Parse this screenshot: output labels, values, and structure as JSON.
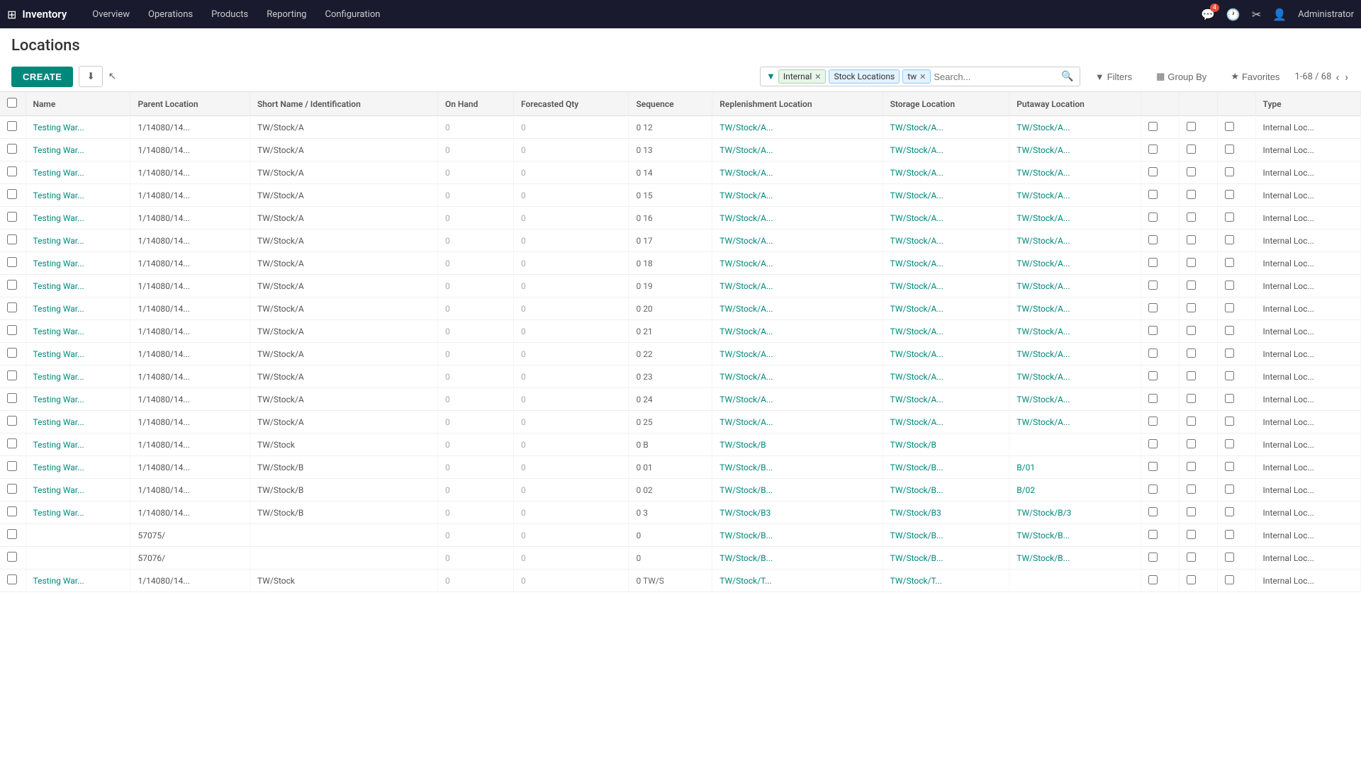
{
  "app": {
    "name": "Inventory",
    "grid_icon": "⊞",
    "nav_items": [
      "Overview",
      "Operations",
      "Products",
      "Reporting",
      "Configuration"
    ]
  },
  "topnav_right": {
    "chat_icon": "💬",
    "chat_badge": "4",
    "clock_icon": "🕐",
    "settings_icon": "⚙",
    "user_icon": "👤",
    "admin_name": "Administrator"
  },
  "page": {
    "title": "Locations"
  },
  "toolbar": {
    "create_label": "CREATE",
    "download_icon": "⬇",
    "filters_label": "Filters",
    "groupby_label": "Group By",
    "favorites_label": "Favorites",
    "filter_internal": "Internal",
    "filter_stock": "Stock Locations",
    "filter_tw": "tw",
    "search_placeholder": "Search...",
    "pagination": "1-68 / 68"
  },
  "table": {
    "columns": [
      "",
      "Name",
      "Parent Location",
      "Short Name / Identification",
      "On Hand",
      "Forecasted Qty",
      "Sequence",
      "Replenishment Location",
      "Storage Location",
      "Putaway Location",
      "",
      "",
      "",
      "Type"
    ],
    "rows": [
      {
        "name": "Testing War...",
        "parent": "1/14080/14...",
        "short": "TW/Stock/A",
        "on_hand": "0",
        "forecast": "0",
        "seq": "0",
        "seq2": "12",
        "loc1": "TW/Stock/A...",
        "loc2": "TW/Stock/A...",
        "loc3": "TW/Stock/A...",
        "type": "Internal Loc..."
      },
      {
        "name": "Testing War...",
        "parent": "1/14080/14...",
        "short": "TW/Stock/A",
        "on_hand": "0",
        "forecast": "0",
        "seq": "0",
        "seq2": "13",
        "loc1": "TW/Stock/A...",
        "loc2": "TW/Stock/A...",
        "loc3": "TW/Stock/A...",
        "type": "Internal Loc..."
      },
      {
        "name": "Testing War...",
        "parent": "1/14080/14...",
        "short": "TW/Stock/A",
        "on_hand": "0",
        "forecast": "0",
        "seq": "0",
        "seq2": "14",
        "loc1": "TW/Stock/A...",
        "loc2": "TW/Stock/A...",
        "loc3": "TW/Stock/A...",
        "type": "Internal Loc..."
      },
      {
        "name": "Testing War...",
        "parent": "1/14080/14...",
        "short": "TW/Stock/A",
        "on_hand": "0",
        "forecast": "0",
        "seq": "0",
        "seq2": "15",
        "loc1": "TW/Stock/A...",
        "loc2": "TW/Stock/A...",
        "loc3": "TW/Stock/A...",
        "type": "Internal Loc..."
      },
      {
        "name": "Testing War...",
        "parent": "1/14080/14...",
        "short": "TW/Stock/A",
        "on_hand": "0",
        "forecast": "0",
        "seq": "0",
        "seq2": "16",
        "loc1": "TW/Stock/A...",
        "loc2": "TW/Stock/A...",
        "loc3": "TW/Stock/A...",
        "type": "Internal Loc..."
      },
      {
        "name": "Testing War...",
        "parent": "1/14080/14...",
        "short": "TW/Stock/A",
        "on_hand": "0",
        "forecast": "0",
        "seq": "0",
        "seq2": "17",
        "loc1": "TW/Stock/A...",
        "loc2": "TW/Stock/A...",
        "loc3": "TW/Stock/A...",
        "type": "Internal Loc..."
      },
      {
        "name": "Testing War...",
        "parent": "1/14080/14...",
        "short": "TW/Stock/A",
        "on_hand": "0",
        "forecast": "0",
        "seq": "0",
        "seq2": "18",
        "loc1": "TW/Stock/A...",
        "loc2": "TW/Stock/A...",
        "loc3": "TW/Stock/A...",
        "type": "Internal Loc..."
      },
      {
        "name": "Testing War...",
        "parent": "1/14080/14...",
        "short": "TW/Stock/A",
        "on_hand": "0",
        "forecast": "0",
        "seq": "0",
        "seq2": "19",
        "loc1": "TW/Stock/A...",
        "loc2": "TW/Stock/A...",
        "loc3": "TW/Stock/A...",
        "type": "Internal Loc..."
      },
      {
        "name": "Testing War...",
        "parent": "1/14080/14...",
        "short": "TW/Stock/A",
        "on_hand": "0",
        "forecast": "0",
        "seq": "0",
        "seq2": "20",
        "loc1": "TW/Stock/A...",
        "loc2": "TW/Stock/A...",
        "loc3": "TW/Stock/A...",
        "type": "Internal Loc..."
      },
      {
        "name": "Testing War...",
        "parent": "1/14080/14...",
        "short": "TW/Stock/A",
        "on_hand": "0",
        "forecast": "0",
        "seq": "0",
        "seq2": "21",
        "loc1": "TW/Stock/A...",
        "loc2": "TW/Stock/A...",
        "loc3": "TW/Stock/A...",
        "type": "Internal Loc..."
      },
      {
        "name": "Testing War...",
        "parent": "1/14080/14...",
        "short": "TW/Stock/A",
        "on_hand": "0",
        "forecast": "0",
        "seq": "0",
        "seq2": "22",
        "loc1": "TW/Stock/A...",
        "loc2": "TW/Stock/A...",
        "loc3": "TW/Stock/A...",
        "type": "Internal Loc..."
      },
      {
        "name": "Testing War...",
        "parent": "1/14080/14...",
        "short": "TW/Stock/A",
        "on_hand": "0",
        "forecast": "0",
        "seq": "0",
        "seq2": "23",
        "loc1": "TW/Stock/A...",
        "loc2": "TW/Stock/A...",
        "loc3": "TW/Stock/A...",
        "type": "Internal Loc..."
      },
      {
        "name": "Testing War...",
        "parent": "1/14080/14...",
        "short": "TW/Stock/A",
        "on_hand": "0",
        "forecast": "0",
        "seq": "0",
        "seq2": "24",
        "loc1": "TW/Stock/A...",
        "loc2": "TW/Stock/A...",
        "loc3": "TW/Stock/A...",
        "type": "Internal Loc..."
      },
      {
        "name": "Testing War...",
        "parent": "1/14080/14...",
        "short": "TW/Stock/A",
        "on_hand": "0",
        "forecast": "0",
        "seq": "0",
        "seq2": "25",
        "loc1": "TW/Stock/A...",
        "loc2": "TW/Stock/A...",
        "loc3": "TW/Stock/A...",
        "type": "Internal Loc..."
      },
      {
        "name": "Testing War...",
        "parent": "1/14080/14...",
        "short": "TW/Stock",
        "on_hand": "0",
        "forecast": "0",
        "seq": "0",
        "seq2": "B",
        "loc1": "TW/Stock/B",
        "loc2": "TW/Stock/B",
        "loc3": "",
        "type": "Internal Loc..."
      },
      {
        "name": "Testing War...",
        "parent": "1/14080/14...",
        "short": "TW/Stock/B",
        "on_hand": "0",
        "forecast": "0",
        "seq": "0",
        "seq2": "01",
        "loc1": "TW/Stock/B...",
        "loc2": "TW/Stock/B...",
        "loc3": "B/01",
        "type": "Internal Loc..."
      },
      {
        "name": "Testing War...",
        "parent": "1/14080/14...",
        "short": "TW/Stock/B",
        "on_hand": "0",
        "forecast": "0",
        "seq": "0",
        "seq2": "02",
        "loc1": "TW/Stock/B...",
        "loc2": "TW/Stock/B...",
        "loc3": "B/02",
        "type": "Internal Loc..."
      },
      {
        "name": "Testing War...",
        "parent": "1/14080/14...",
        "short": "TW/Stock/B",
        "on_hand": "0",
        "forecast": "0",
        "seq": "0",
        "seq2": "3",
        "loc1": "TW/Stock/B3",
        "loc2": "TW/Stock/B3",
        "loc3": "TW/Stock/B/3",
        "type": "Internal Loc..."
      },
      {
        "name": "",
        "parent": "57075/",
        "short": "",
        "on_hand": "0",
        "forecast": "0",
        "seq": "0",
        "seq2": "",
        "loc1": "TW/Stock/B...",
        "loc2": "TW/Stock/B...",
        "loc3": "TW/Stock/B...",
        "type": "Internal Loc..."
      },
      {
        "name": "",
        "parent": "57076/",
        "short": "",
        "on_hand": "0",
        "forecast": "0",
        "seq": "0",
        "seq2": "",
        "loc1": "TW/Stock/B...",
        "loc2": "TW/Stock/B...",
        "loc3": "TW/Stock/B...",
        "type": "Internal Loc..."
      },
      {
        "name": "Testing War...",
        "parent": "1/14080/14...",
        "short": "TW/Stock",
        "on_hand": "0",
        "forecast": "0",
        "seq": "0",
        "seq2": "TW/S",
        "loc1": "TW/Stock/T...",
        "loc2": "TW/Stock/T...",
        "loc3": "",
        "type": "Internal Loc..."
      }
    ]
  }
}
